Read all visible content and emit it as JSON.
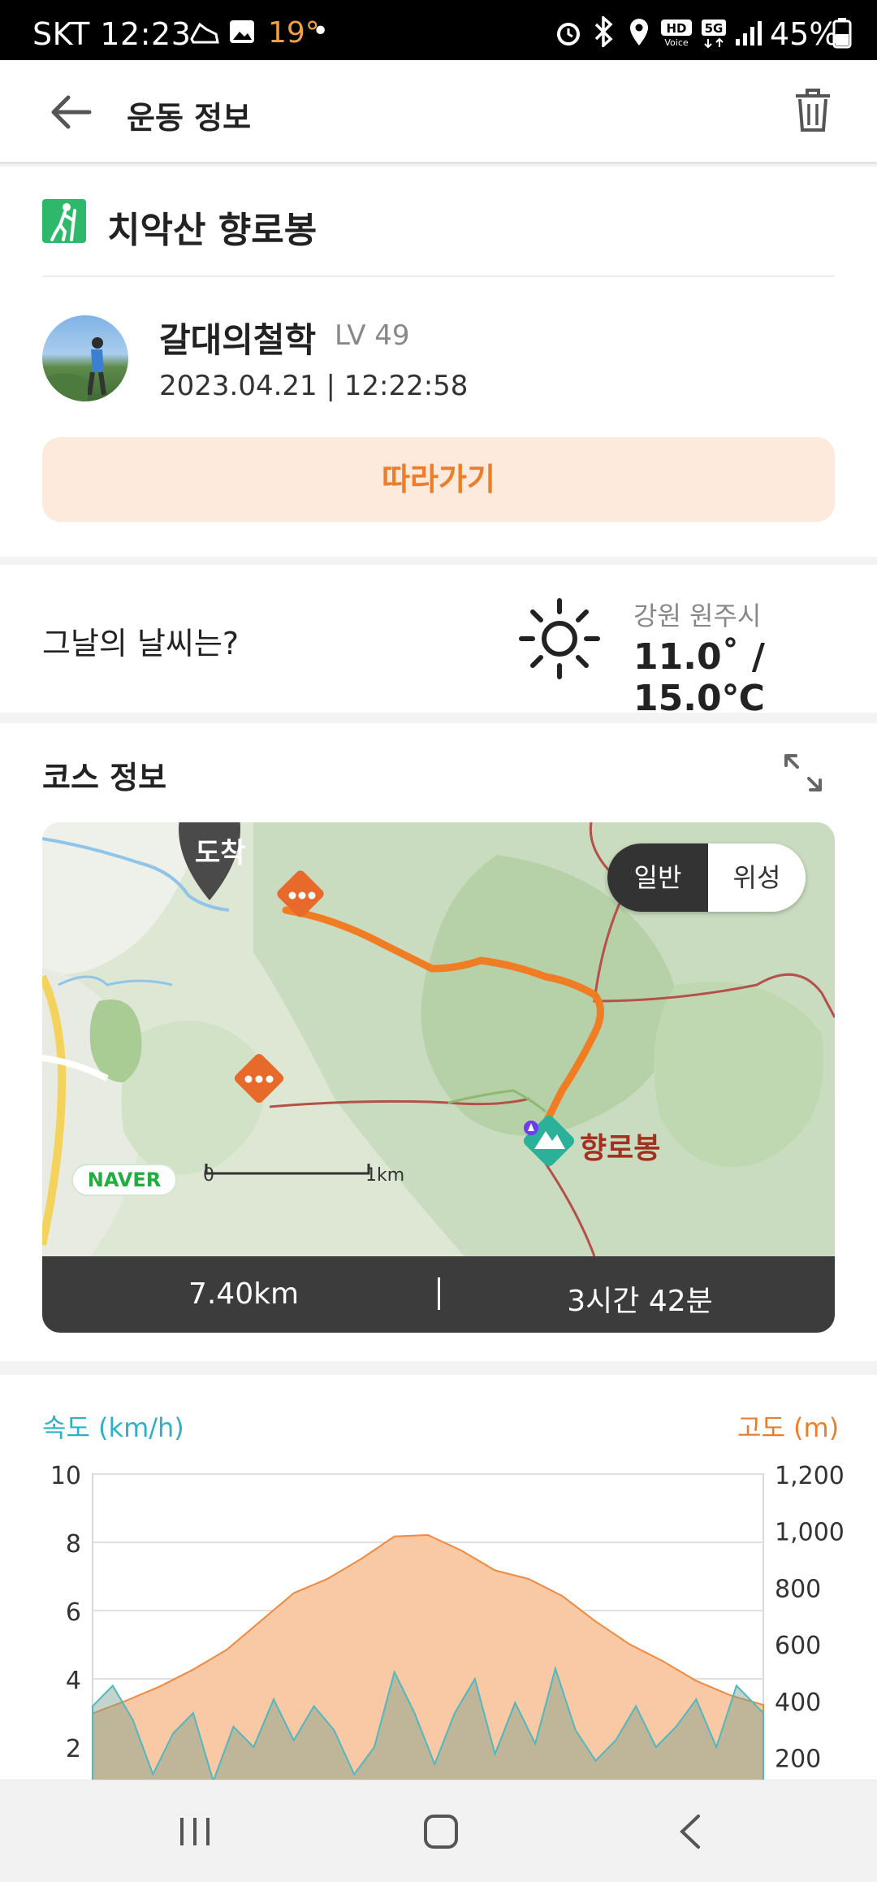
{
  "status_bar": {
    "carrier_time": "SKT 12:23",
    "temperature": "19°",
    "battery": "45%"
  },
  "app_bar": {
    "title": "운동 정보"
  },
  "activity": {
    "name": "치악산 향로봉",
    "user": {
      "name": "갈대의철학",
      "level": "LV 49",
      "datetime": "2023.04.21 | 12:22:58"
    },
    "follow_label": "따라가기"
  },
  "weather": {
    "question": "그날의 날씨는?",
    "location": "강원 원주시",
    "temps": "11.0˚ / 15.0℃",
    "icon": "sun-icon"
  },
  "course": {
    "title": "코스 정보",
    "map": {
      "arrival_label": "도착",
      "peak_label": "향로봉",
      "toggle": {
        "normal": "일반",
        "satellite": "위성"
      },
      "brand": "NAVER",
      "scale_start": "0",
      "scale_end": "1km"
    },
    "distance": "7.40km",
    "duration": "3시간 42분"
  },
  "chart_data": {
    "type": "area",
    "left_axis_label": "속도 (km/h)",
    "right_axis_label": "고도 (m)",
    "left_ticks": [
      "10",
      "8",
      "6",
      "4",
      "2"
    ],
    "right_ticks": [
      "1,200",
      "1,000",
      "800",
      "600",
      "400",
      "200"
    ],
    "left_ylim": [
      0,
      10
    ],
    "right_ylim": [
      0,
      1200
    ],
    "series": [
      {
        "name": "고도 (m)",
        "color": "#f08a40",
        "x": [
          0,
          5,
          10,
          15,
          20,
          25,
          30,
          35,
          40,
          45,
          50,
          55,
          60,
          65,
          70,
          75,
          80,
          85,
          90,
          95,
          100
        ],
        "values": [
          355,
          400,
          450,
          510,
          580,
          680,
          780,
          830,
          900,
          980,
          985,
          930,
          860,
          830,
          770,
          680,
          600,
          540,
          470,
          420,
          385
        ]
      },
      {
        "name": "속도 (km/h)",
        "color": "#4fb8c0",
        "x": [
          0,
          3,
          6,
          9,
          12,
          15,
          18,
          21,
          24,
          27,
          30,
          33,
          36,
          39,
          42,
          45,
          48,
          51,
          54,
          57,
          60,
          63,
          66,
          69,
          72,
          75,
          78,
          81,
          84,
          87,
          90,
          93,
          96,
          100
        ],
        "values": [
          3.2,
          3.8,
          2.8,
          1.2,
          2.4,
          3.0,
          1.0,
          2.6,
          2.0,
          3.4,
          2.2,
          3.2,
          2.5,
          1.2,
          2.0,
          4.2,
          3.0,
          1.5,
          3.0,
          4.0,
          1.8,
          3.3,
          2.1,
          4.3,
          2.5,
          1.6,
          2.2,
          3.2,
          2.0,
          2.6,
          3.4,
          2.0,
          3.8,
          3.0
        ]
      }
    ]
  },
  "nav": {
    "recents_icon": "recents-icon",
    "home_icon": "home-icon",
    "back_icon": "back-nav-icon"
  }
}
